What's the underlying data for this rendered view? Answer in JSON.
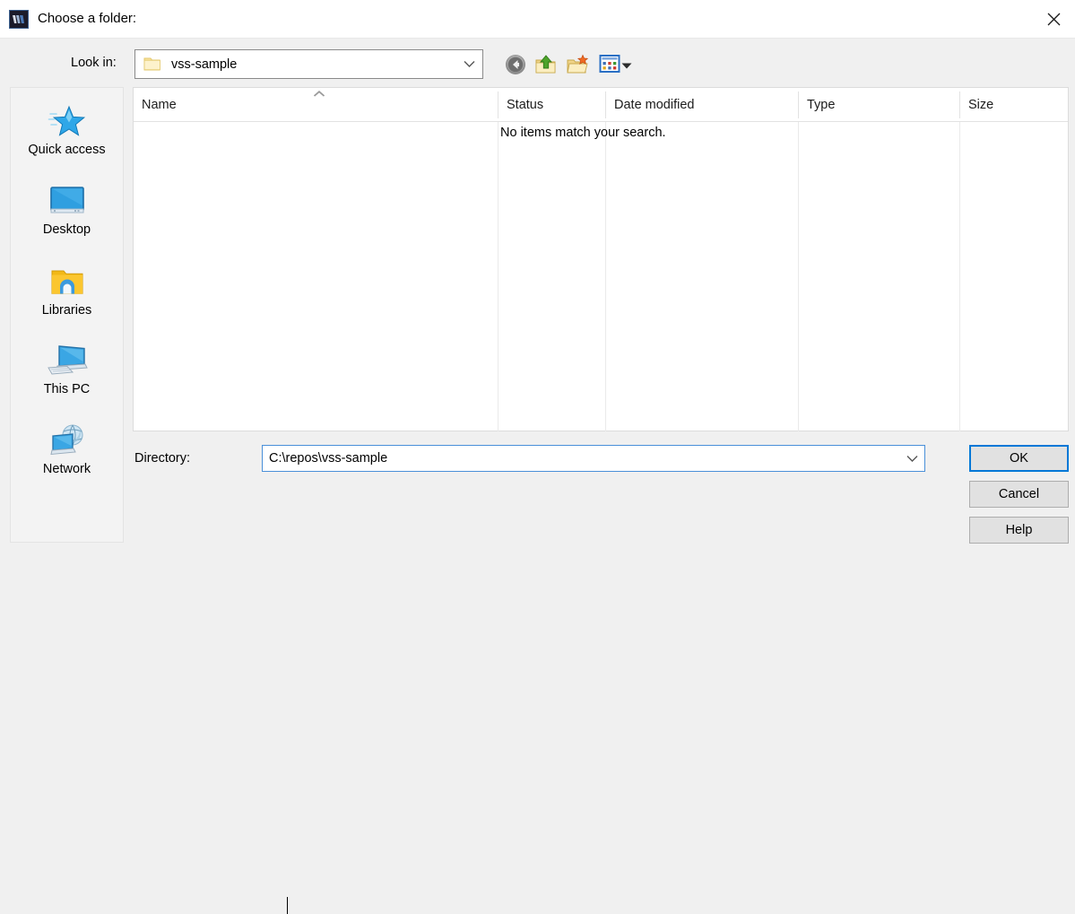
{
  "window": {
    "title": "Choose a folder:",
    "icon": "app-icon",
    "close_icon": "close-icon"
  },
  "toolbar": {
    "lookin_label": "Look in:",
    "lookin_value": "vss-sample",
    "lookin_folder_icon": "folder-icon",
    "lookin_dropdown_icon": "chevron-down-icon",
    "back_icon": "back-arrow-icon",
    "up_icon": "up-one-level-folder-icon",
    "new_folder_icon": "new-folder-icon",
    "views_icon": "views-grid-icon",
    "views_dropdown_icon": "triangle-down-icon"
  },
  "places": {
    "items": [
      {
        "label": "Quick access",
        "icon": "star-icon"
      },
      {
        "label": "Desktop",
        "icon": "monitor-icon"
      },
      {
        "label": "Libraries",
        "icon": "libraries-folder-icon"
      },
      {
        "label": "This PC",
        "icon": "computer-icon"
      },
      {
        "label": "Network",
        "icon": "network-globe-icon"
      }
    ]
  },
  "filelist": {
    "columns": [
      {
        "label": "Name"
      },
      {
        "label": "Status"
      },
      {
        "label": "Date modified"
      },
      {
        "label": "Type"
      },
      {
        "label": "Size"
      }
    ],
    "sort_indicator_icon": "chevron-up-icon",
    "empty_message": "No items match your search.",
    "rows": []
  },
  "directory": {
    "label": "Directory:",
    "value": "C:\\repos\\vss-sample",
    "dropdown_icon": "chevron-down-icon"
  },
  "buttons": {
    "ok": "OK",
    "cancel": "Cancel",
    "help": "Help"
  },
  "colors": {
    "accent": "#0078d7",
    "focus_border": "#4a90d9",
    "dialog_bg": "#f0f0f0",
    "panel_bg": "#f3f3f3",
    "button_bg": "#e1e1e1"
  }
}
